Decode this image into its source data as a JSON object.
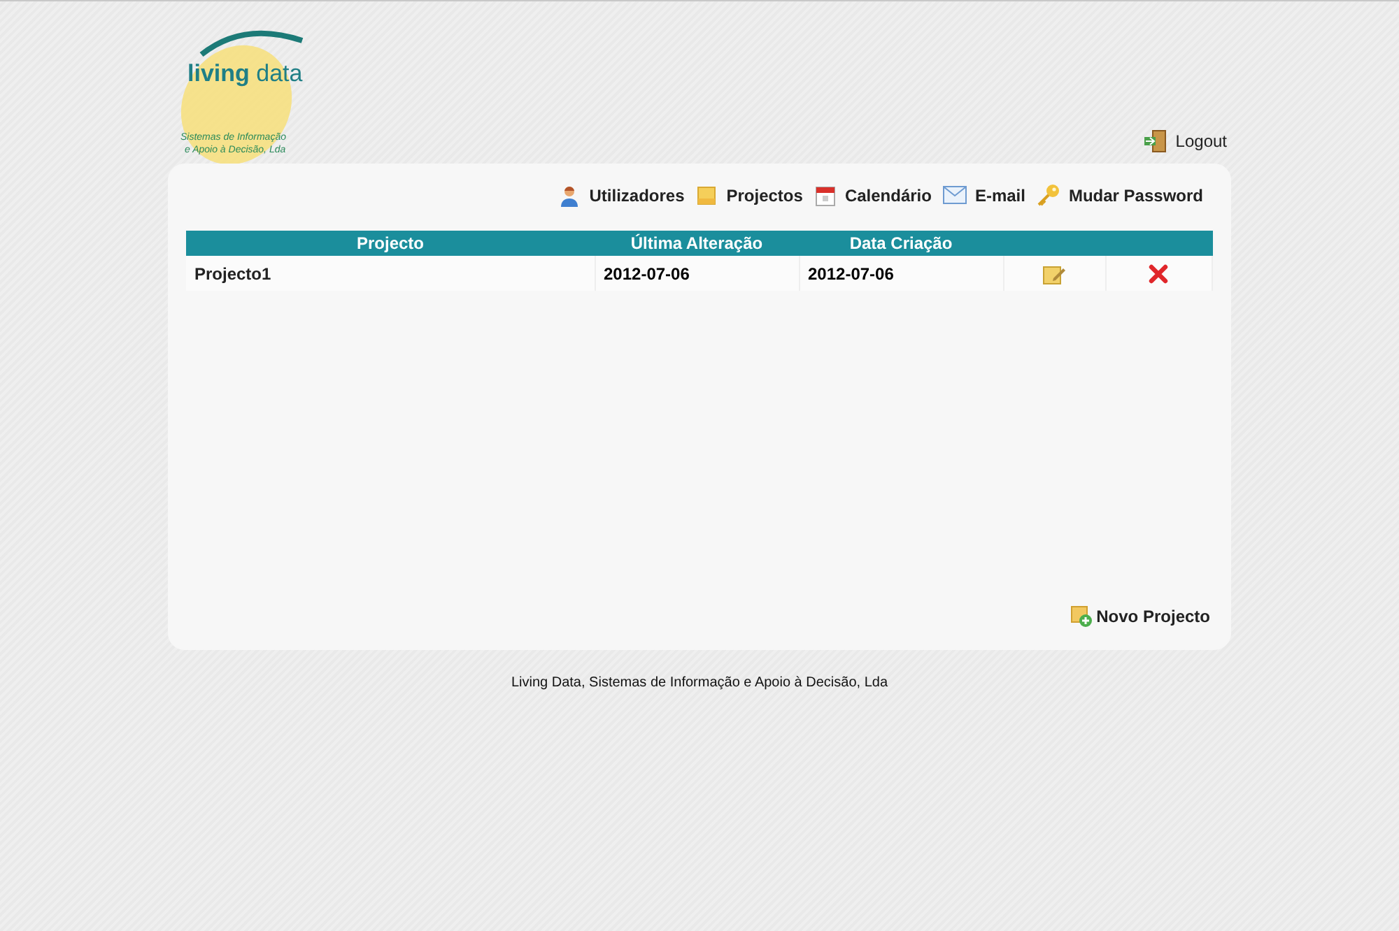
{
  "logo": {
    "name": "**living** data",
    "tagline": [
      "Sistemas de Informação",
      "e Apoio à Decisão, Lda"
    ]
  },
  "logout": {
    "label": "Logout"
  },
  "nav": [
    {
      "kind": "users",
      "label": "Utilizadores"
    },
    {
      "kind": "projects",
      "label": "Projectos"
    },
    {
      "kind": "calendar",
      "label": "Calendário"
    },
    {
      "kind": "email",
      "label": "E-mail"
    },
    {
      "kind": "password",
      "label": "Mudar Password"
    }
  ],
  "table": {
    "columns": [
      "Projecto",
      "Última Alteração",
      "Data Criação"
    ],
    "rows": [
      {
        "name": "Projecto1",
        "modified": "2012-07-06",
        "created": "2012-07-06"
      }
    ]
  },
  "new_project": {
    "label": "Novo Projecto"
  },
  "footer": "Living Data, Sistemas de Informação e Apoio à Decisão, Lda"
}
